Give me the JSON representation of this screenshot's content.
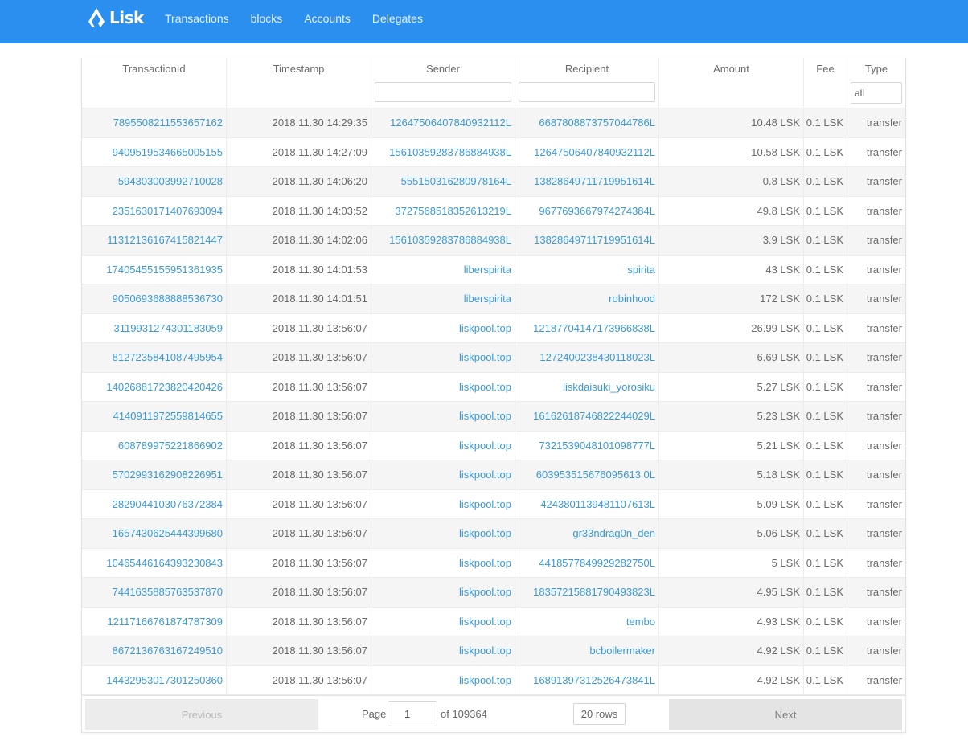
{
  "header": {
    "logo_text": "Lisk",
    "nav": [
      "Transactions",
      "blocks",
      "Accounts",
      "Delegates"
    ]
  },
  "table": {
    "columns": [
      "TransactionId",
      "Timestamp",
      "Sender",
      "Recipient",
      "Amount",
      "Fee",
      "Type"
    ],
    "type_filter_value": "all",
    "rows": [
      [
        "7895508211553657162",
        "2018.11.30 14:29:35",
        "12647506407840932112L",
        "6687808873757044786L",
        "10.48 LSK",
        "0.1 LSK",
        "transfer"
      ],
      [
        "9409519534665005155",
        "2018.11.30 14:27:09",
        "15610359283786884938L",
        "12647506407840932112L",
        "10.58 LSK",
        "0.1 LSK",
        "transfer"
      ],
      [
        "594303003992710028",
        "2018.11.30 14:06:20",
        "555150316280978164L",
        "13828649711719951614L",
        "0.8 LSK",
        "0.1 LSK",
        "transfer"
      ],
      [
        "2351630171407693094",
        "2018.11.30 14:03:52",
        "3727568518352613219L",
        "9677693667974274384L",
        "49.8 LSK",
        "0.1 LSK",
        "transfer"
      ],
      [
        "11312136167415821447",
        "2018.11.30 14:02:06",
        "15610359283786884938L",
        "13828649711719951614L",
        "3.9 LSK",
        "0.1 LSK",
        "transfer"
      ],
      [
        "17405455155951361935",
        "2018.11.30 14:01:53",
        "liberspirita",
        "spirita",
        "43 LSK",
        "0.1 LSK",
        "transfer"
      ],
      [
        "9050693688888536730",
        "2018.11.30 14:01:51",
        "liberspirita",
        "robinhood",
        "172 LSK",
        "0.1 LSK",
        "transfer"
      ],
      [
        "3119931274301183059",
        "2018.11.30 13:56:07",
        "liskpool.top",
        "12187704147173966838L",
        "26.99 LSK",
        "0.1 LSK",
        "transfer"
      ],
      [
        "8127235841087495954",
        "2018.11.30 13:56:07",
        "liskpool.top",
        "1272400238430118023L",
        "6.69 LSK",
        "0.1 LSK",
        "transfer"
      ],
      [
        "14026881723820420426",
        "2018.11.30 13:56:07",
        "liskpool.top",
        "liskdaisuki_yorosiku",
        "5.27 LSK",
        "0.1 LSK",
        "transfer"
      ],
      [
        "4140911972559814655",
        "2018.11.30 13:56:07",
        "liskpool.top",
        "16162618746822244029L",
        "5.23 LSK",
        "0.1 LSK",
        "transfer"
      ],
      [
        "608789975221866902",
        "2018.11.30 13:56:07",
        "liskpool.top",
        "7321539048101098777L",
        "5.21 LSK",
        "0.1 LSK",
        "transfer"
      ],
      [
        "5702993162908226951",
        "2018.11.30 13:56:07",
        "liskpool.top",
        "603953515676095613 0L",
        "5.18 LSK",
        "0.1 LSK",
        "transfer"
      ],
      [
        "2829044103076372384",
        "2018.11.30 13:56:07",
        "liskpool.top",
        "4243801139481107613L",
        "5.09 LSK",
        "0.1 LSK",
        "transfer"
      ],
      [
        "1657430625444399680",
        "2018.11.30 13:56:07",
        "liskpool.top",
        "gr33ndrag0n_den",
        "5.06 LSK",
        "0.1 LSK",
        "transfer"
      ],
      [
        "10465446164393230843",
        "2018.11.30 13:56:07",
        "liskpool.top",
        "4418577849929282750L",
        "5 LSK",
        "0.1 LSK",
        "transfer"
      ],
      [
        "7441635885763537870",
        "2018.11.30 13:56:07",
        "liskpool.top",
        "18357215881790493823L",
        "4.95 LSK",
        "0.1 LSK",
        "transfer"
      ],
      [
        "12117166761874787309",
        "2018.11.30 13:56:07",
        "liskpool.top",
        "tembo",
        "4.93 LSK",
        "0.1 LSK",
        "transfer"
      ],
      [
        "8672136763167249510",
        "2018.11.30 13:56:07",
        "liskpool.top",
        "bcboilermaker",
        "4.92 LSK",
        "0.1 LSK",
        "transfer"
      ],
      [
        "14432953017301250360",
        "2018.11.30 13:56:07",
        "liskpool.top",
        "16891397312526473841L",
        "4.92 LSK",
        "0.1 LSK",
        "transfer"
      ]
    ]
  },
  "pagination": {
    "previous_label": "Previous",
    "page_label": "Page",
    "page_value": "1",
    "of_label": "of 109364",
    "rows_label": "20 rows",
    "next_label": "Next"
  }
}
